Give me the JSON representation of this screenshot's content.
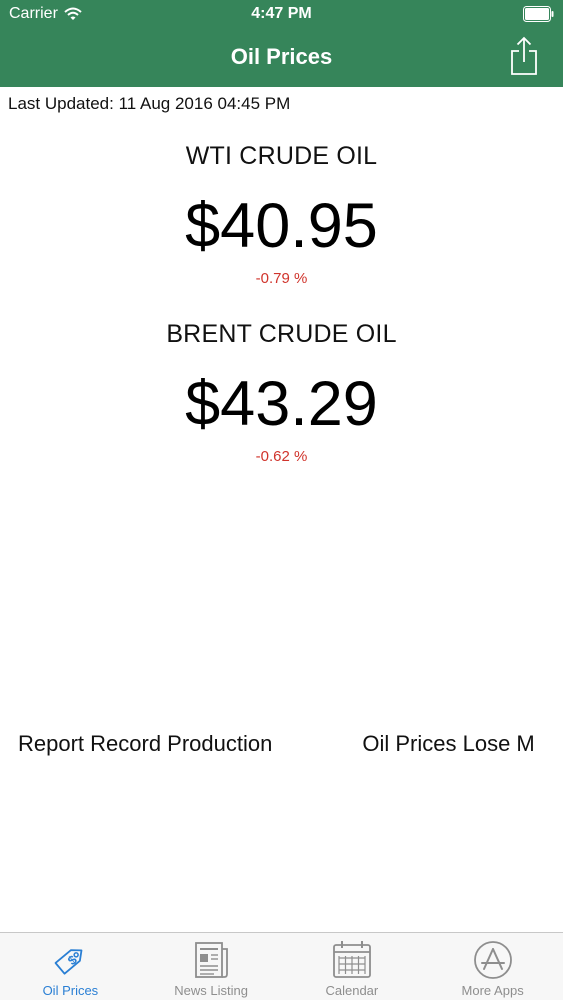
{
  "status_bar": {
    "carrier": "Carrier",
    "time": "4:47 PM"
  },
  "nav": {
    "title": "Oil Prices"
  },
  "last_updated": "Last Updated: 11 Aug 2016 04:45 PM",
  "oils": [
    {
      "name": "WTI CRUDE OIL",
      "price": "$40.95",
      "change": "-0.79 %"
    },
    {
      "name": "BRENT CRUDE OIL",
      "price": "$43.29",
      "change": "-0.62 %"
    }
  ],
  "ticker": [
    "Report Record Production",
    "Oil Prices Lose M"
  ],
  "tabs": [
    {
      "label": "Oil Prices",
      "icon": "price-tag-icon",
      "active": true
    },
    {
      "label": "News Listing",
      "icon": "newspaper-icon",
      "active": false
    },
    {
      "label": "Calendar",
      "icon": "calendar-icon",
      "active": false
    },
    {
      "label": "More Apps",
      "icon": "app-store-icon",
      "active": false
    }
  ],
  "colors": {
    "header": "#36855a",
    "negative": "#d0342c",
    "tab_active": "#2a7fd4",
    "tab_inactive": "#8e8e8e"
  }
}
